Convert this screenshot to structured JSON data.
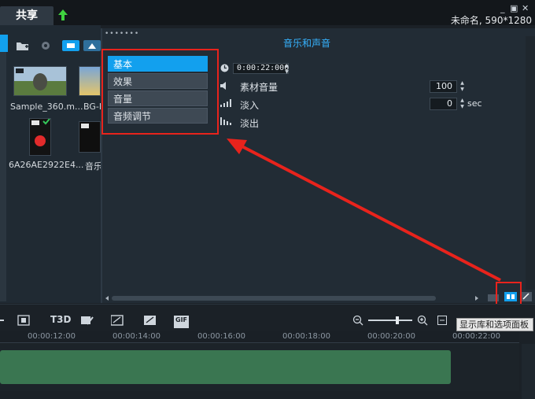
{
  "titlebar": {
    "share_tab": "共享",
    "project_name": "未命名, 590*1280",
    "minimize": "_",
    "restore": "▣",
    "close": "✕"
  },
  "library": {
    "items": [
      {
        "label": "Sample_360.m..."
      },
      {
        "label": "BG-E"
      },
      {
        "label": "6A26AE2922E4..."
      },
      {
        "label": "音乐"
      }
    ]
  },
  "options": {
    "title": "音乐和声音",
    "tabs": [
      "基本",
      "效果",
      "音量",
      "音频调节"
    ],
    "active_tab": "基本",
    "duration": "0:00:22:000",
    "clip_volume_label": "素材音量",
    "clip_volume": "100",
    "fade_in_label": "淡入",
    "fade_in_value": "0",
    "fade_in_unit": "sec",
    "fade_out_label": "淡出"
  },
  "timeline": {
    "ruler": [
      "00:00:12:00",
      "00:00:14:00",
      "00:00:16:00",
      "00:00:18:00",
      "00:00:20:00",
      "00:00:22:00"
    ],
    "tooltip": "显示库和选项面板",
    "tools": [
      "T3D",
      "GIF"
    ]
  },
  "colors": {
    "accent": "#12a0ee",
    "title": "#36b3ff",
    "highlight": "#e8231c",
    "clip": "#3a7651"
  }
}
